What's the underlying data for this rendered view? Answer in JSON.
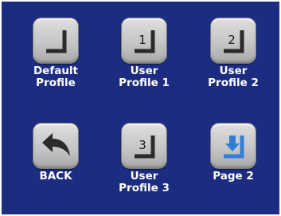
{
  "buttons": [
    {
      "id": "default",
      "label_line1": "Default",
      "label_line2": "Profile",
      "icon": "profile-slot-icon",
      "number": ""
    },
    {
      "id": "user1",
      "label_line1": "User",
      "label_line2": "Profile 1",
      "icon": "profile-slot-icon",
      "number": "1"
    },
    {
      "id": "user2",
      "label_line1": "User",
      "label_line2": "Profile 2",
      "icon": "profile-slot-icon",
      "number": "2"
    },
    {
      "id": "back",
      "label_line1": "BACK",
      "label_line2": "",
      "icon": "back-arrow-icon",
      "number": ""
    },
    {
      "id": "user3",
      "label_line1": "User",
      "label_line2": "Profile 3",
      "icon": "profile-slot-icon",
      "number": "3"
    },
    {
      "id": "page2",
      "label_line1": "Page 2",
      "label_line2": "",
      "icon": "download-arrow-icon",
      "number": ""
    }
  ],
  "colors": {
    "background": "#1c2c80",
    "label": "#ffffff",
    "button_face": "#c6c6c6",
    "accent_arrow": "#2f7fd6"
  }
}
